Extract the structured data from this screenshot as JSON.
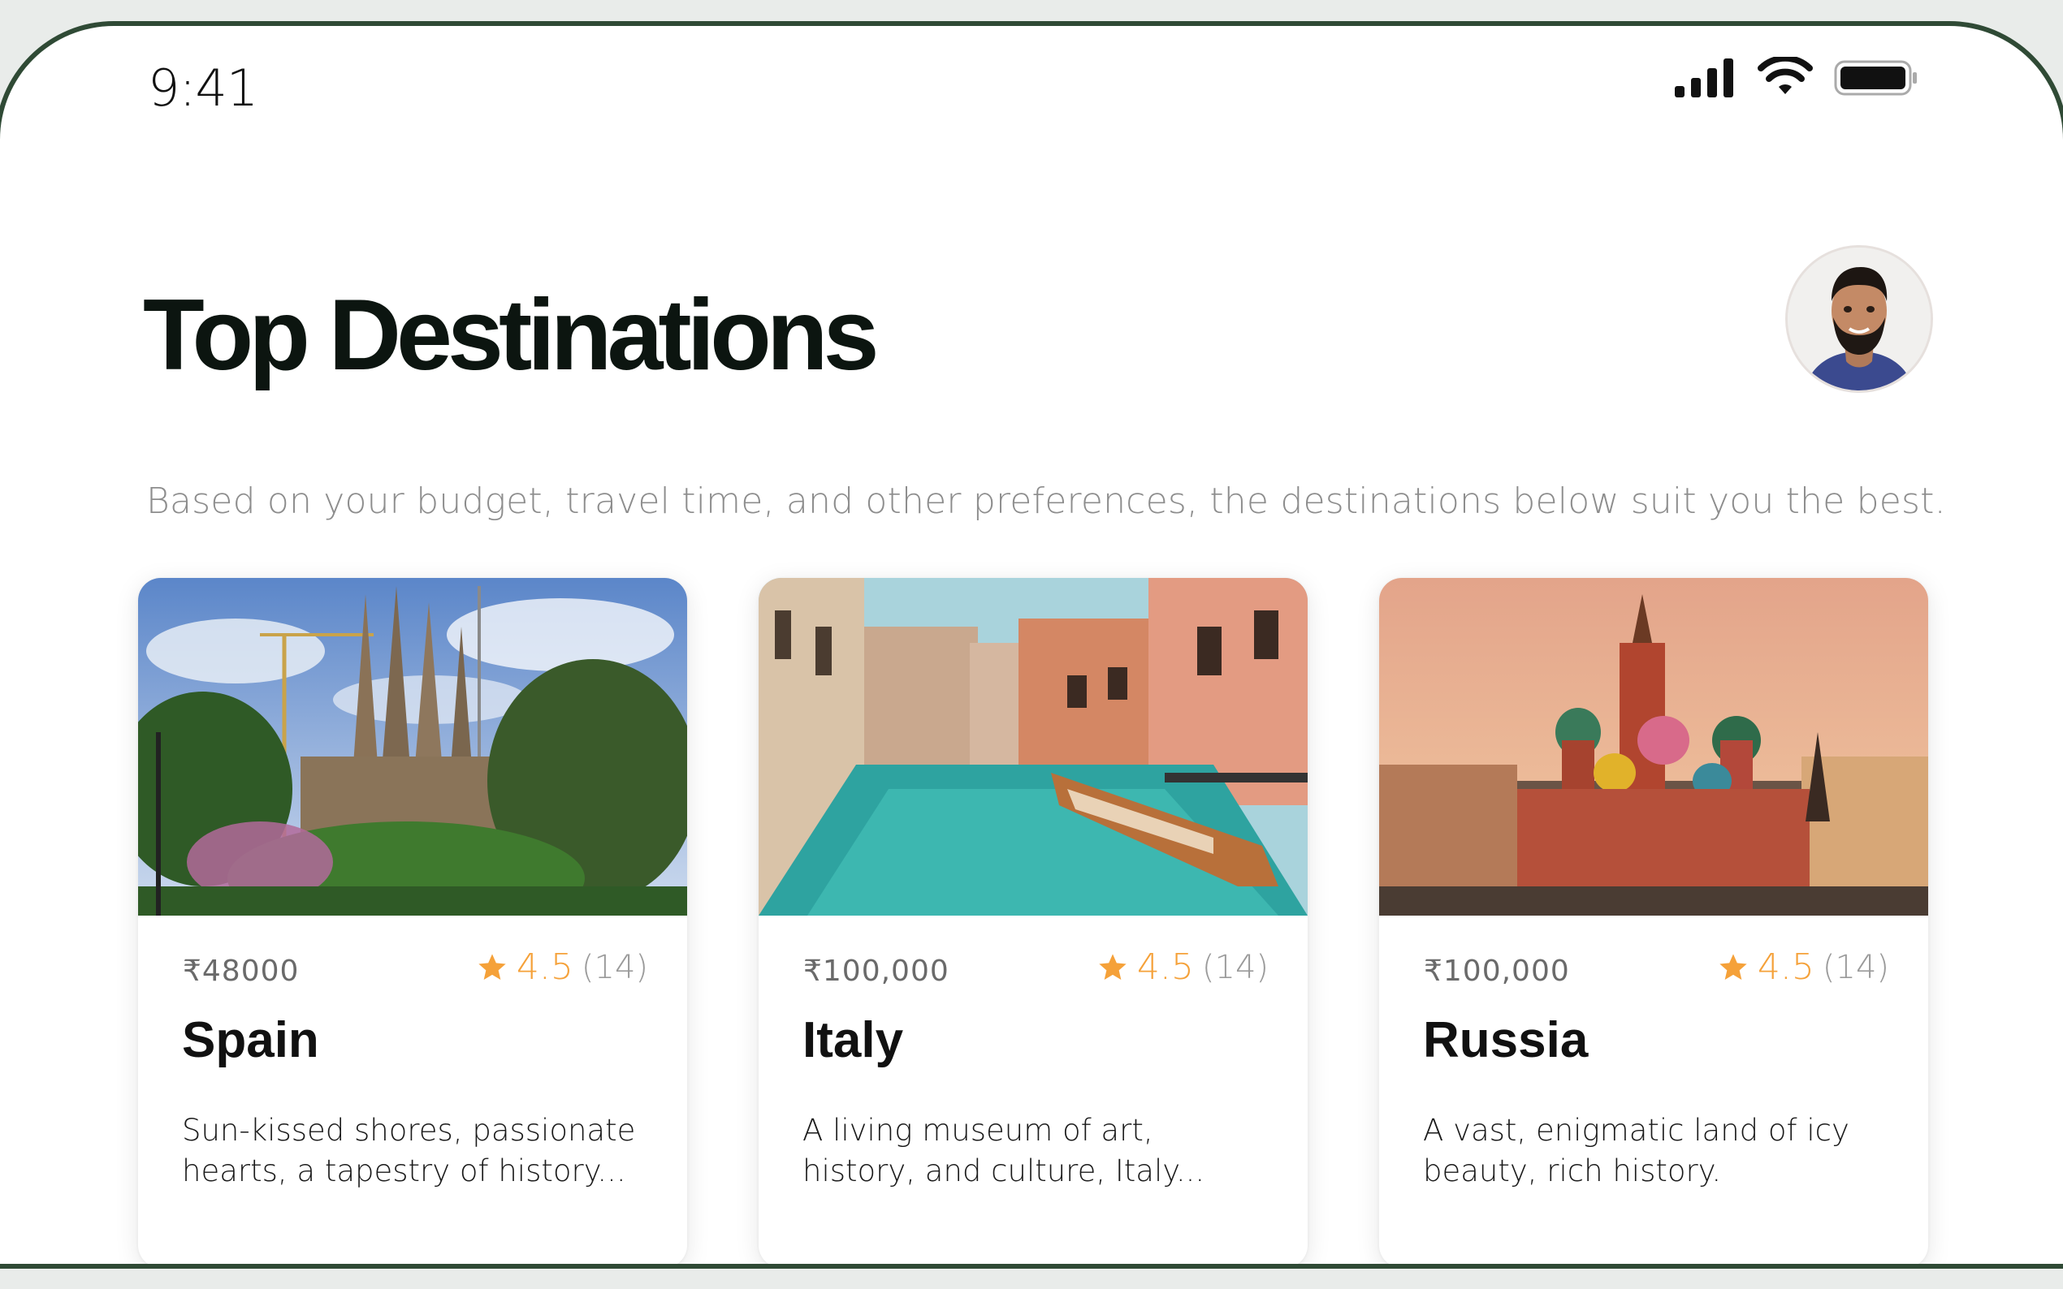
{
  "status_bar": {
    "time": "9:41",
    "icons": [
      "signal-icon",
      "wifi-icon",
      "battery-icon"
    ]
  },
  "header": {
    "title": "Top Destinations",
    "avatar": "user-avatar"
  },
  "subtitle": "Based on your budget, travel time, and other preferences, the destinations below suit you the best.",
  "colors": {
    "accent_star": "#f5a139",
    "title": "#0c1510",
    "muted_text": "#8d8d8d"
  },
  "destinations": [
    {
      "price": "₹48000",
      "rating": "4.5",
      "reviews": "(14)",
      "name": "Spain",
      "description": "Sun-kissed shores, passionate hearts, a tapestry of history...",
      "image": "sagrada-familia-photo"
    },
    {
      "price": "₹100,000",
      "rating": "4.5",
      "reviews": "(14)",
      "name": "Italy",
      "description": "A living museum of art, history, and culture, Italy...",
      "image": "venice-canal-photo"
    },
    {
      "price": "₹100,000",
      "rating": "4.5",
      "reviews": "(14)",
      "name": "Russia",
      "description": "A vast, enigmatic land of icy beauty, rich history.",
      "image": "st-basils-cathedral-photo"
    }
  ]
}
